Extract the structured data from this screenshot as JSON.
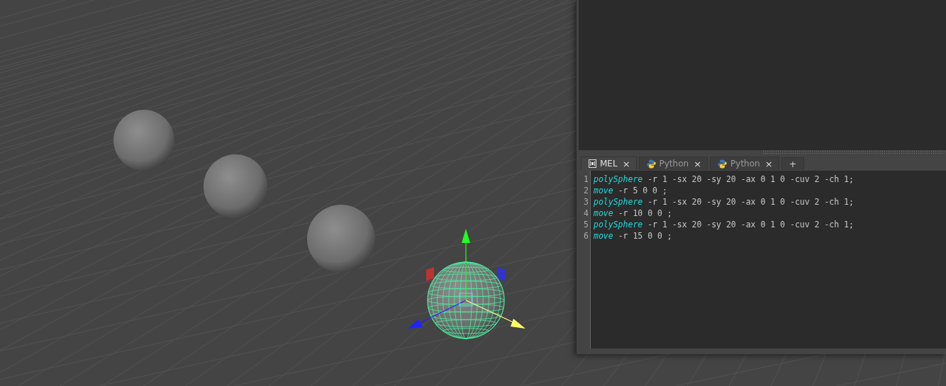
{
  "script_editor": {
    "tabs": [
      {
        "kind": "mel",
        "label": "MEL",
        "close": "×",
        "selected": true
      },
      {
        "kind": "python",
        "label": "Python",
        "close": "×",
        "selected": false
      },
      {
        "kind": "python",
        "label": "Python",
        "close": "×",
        "selected": false
      },
      {
        "kind": "add",
        "label": "+"
      }
    ],
    "lines": [
      {
        "number": "1",
        "command": "polySphere",
        "args": " -r 1 -sx 20 -sy 20 -ax 0 1 0 -cuv 2 -ch 1;"
      },
      {
        "number": "2",
        "command": "move",
        "args": " -r 5 0 0 ;"
      },
      {
        "number": "3",
        "command": "polySphere",
        "args": " -r 1 -sx 20 -sy 20 -ax 0 1 0 -cuv 2 -ch 1;"
      },
      {
        "number": "4",
        "command": "move",
        "args": " -r 10 0 0 ;"
      },
      {
        "number": "5",
        "command": "polySphere",
        "args": " -r 1 -sx 20 -sy 20 -ax 0 1 0 -cuv 2 -ch 1;"
      },
      {
        "number": "6",
        "command": "move",
        "args": " -r 15 0 0 ;"
      }
    ]
  }
}
